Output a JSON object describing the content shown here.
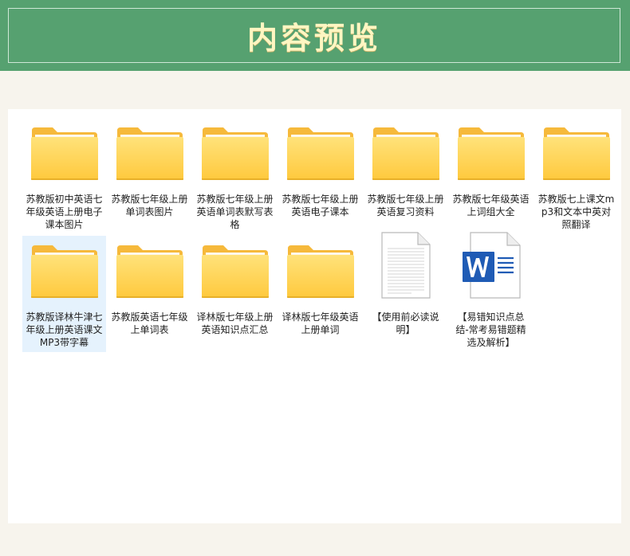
{
  "header": {
    "title": "内容预览"
  },
  "files": [
    {
      "name": "苏教版初中英语七年级英语上册电子课本图片",
      "type": "folder-icon",
      "selected": false
    },
    {
      "name": "苏教版七年级上册单词表图片",
      "type": "folder-icon",
      "selected": false
    },
    {
      "name": "苏教版七年级上册英语单词表默写表格",
      "type": "folder-icon",
      "selected": false
    },
    {
      "name": "苏教版七年级上册英语电子课本",
      "type": "folder-icon",
      "selected": false
    },
    {
      "name": "苏教版七年级上册英语复习资料",
      "type": "folder-icon",
      "selected": false
    },
    {
      "name": "苏教版七年级英语上词组大全",
      "type": "folder-icon",
      "selected": false
    },
    {
      "name": "苏教版七上课文mp3和文本中英对照翻译",
      "type": "folder-icon",
      "selected": false
    },
    {
      "name": "苏教版译林牛津七年级上册英语课文MP3带字幕",
      "type": "folder-icon",
      "selected": true
    },
    {
      "name": "苏教版英语七年级上单词表",
      "type": "folder-icon",
      "selected": false
    },
    {
      "name": "译林版七年级上册英语知识点汇总",
      "type": "folder-icon",
      "selected": false
    },
    {
      "name": "译林版七年级英语上册单词",
      "type": "folder-icon",
      "selected": false
    },
    {
      "name": "【使用前必读说明】",
      "type": "text-file-icon",
      "selected": false
    },
    {
      "name": "【易错知识点总结-常考易错题精选及解析】",
      "type": "word-doc-icon",
      "selected": false
    }
  ],
  "colors": {
    "header_bg": "#56a170",
    "title": "#fff6c2",
    "folder_back": "#f6b93b",
    "folder_front": "#ffd866",
    "word_blue": "#1f5bb5"
  }
}
